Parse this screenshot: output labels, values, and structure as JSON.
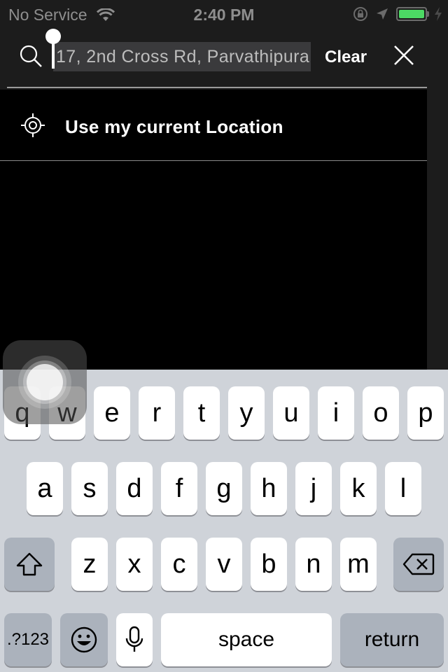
{
  "status_bar": {
    "carrier": "No Service",
    "time": "2:40 PM"
  },
  "search": {
    "value": "17, 2nd Cross Rd, Parvathipura",
    "clear_label": "Clear"
  },
  "results": {
    "current_location_label": "Use my current Location"
  },
  "keyboard": {
    "row1": [
      "q",
      "w",
      "e",
      "r",
      "t",
      "y",
      "u",
      "i",
      "o",
      "p"
    ],
    "row2": [
      "a",
      "s",
      "d",
      "f",
      "g",
      "h",
      "j",
      "k",
      "l"
    ],
    "row3": [
      "z",
      "x",
      "c",
      "v",
      "b",
      "n",
      "m"
    ],
    "numbers_label": ".?123",
    "space_label": "space",
    "return_label": "return"
  },
  "colors": {
    "header_bg": "#1c1c1c",
    "battery": "#4cd964",
    "keyboard_bg": "#cfd3d9"
  }
}
